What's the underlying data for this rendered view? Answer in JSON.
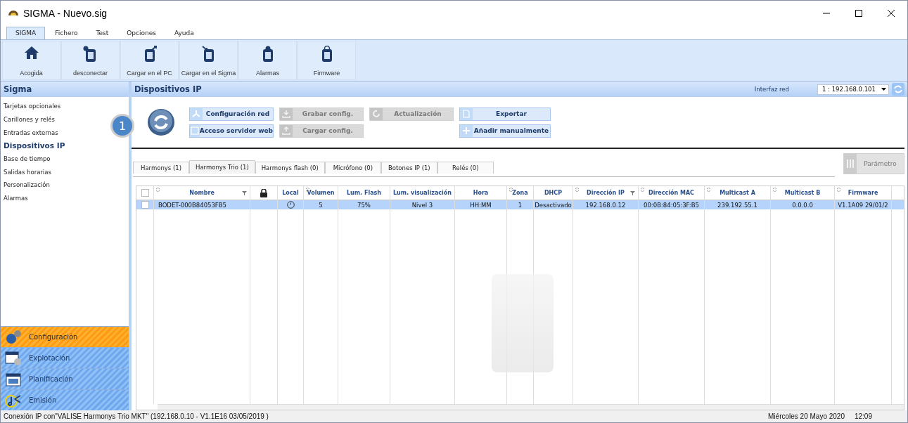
{
  "window": {
    "title": "SIGMA - Nuevo.sig"
  },
  "menu_tabs": [
    {
      "label": "SIGMA",
      "selected": true
    },
    {
      "label": "Fichero",
      "selected": false
    },
    {
      "label": "Test",
      "selected": false
    },
    {
      "label": "Opciones",
      "selected": false
    },
    {
      "label": "Ayuda",
      "selected": false
    }
  ],
  "ribbon": [
    {
      "label": "Acogida",
      "kind": "home"
    },
    {
      "label": "desconectar",
      "kind": "disconnect"
    },
    {
      "label": "Cargar en el PC",
      "kind": "upload"
    },
    {
      "label": "Cargar en el Sigma",
      "kind": "download"
    },
    {
      "label": "Alarmas",
      "kind": "alarm"
    },
    {
      "label": "Firmware",
      "kind": "firmware"
    }
  ],
  "sidebar": {
    "title": "Sigma",
    "items": [
      {
        "label": "Tarjetas opcionales",
        "selected": false
      },
      {
        "label": "Carillones y relés",
        "selected": false
      },
      {
        "label": "Entradas externas",
        "selected": false
      },
      {
        "label": "Dispositivos IP",
        "selected": true
      },
      {
        "label": "Base de tiempo",
        "selected": false
      },
      {
        "label": "Salidas horarias",
        "selected": false
      },
      {
        "label": "Personalización",
        "selected": false
      },
      {
        "label": "Alarmas",
        "selected": false
      }
    ],
    "sections": [
      {
        "label": "Configuración",
        "selected": true,
        "kind": "gears"
      },
      {
        "label": "Explotación",
        "selected": false,
        "kind": "window"
      },
      {
        "label": "Planificación",
        "selected": false,
        "kind": "calendar"
      },
      {
        "label": "Emisión",
        "selected": false,
        "kind": "music"
      }
    ]
  },
  "panel": {
    "title": "Dispositivos IP",
    "interface_label": "Interfaz red",
    "interface_value": "1 : 192.168.0.101",
    "callout": "1",
    "actions": [
      {
        "label": "Configuración red",
        "disabled": false,
        "kind": "network"
      },
      {
        "label": "Grabar config.",
        "disabled": true,
        "kind": "save"
      },
      {
        "label": "Actualización",
        "disabled": true,
        "kind": "update"
      },
      {
        "label": "Exportar",
        "disabled": false,
        "kind": "export"
      },
      {
        "label": "Acceso servidor web",
        "disabled": false,
        "kind": "web"
      },
      {
        "label": "Cargar config.",
        "disabled": true,
        "kind": "load"
      },
      {
        "label": "Añadir manualmente",
        "disabled": false,
        "kind": "add"
      }
    ],
    "device_tabs": [
      {
        "label": "Harmonys (1)",
        "selected": false
      },
      {
        "label": "Harmonys Trio (1)",
        "selected": true
      },
      {
        "label": "Harmonys flash (0)",
        "selected": false
      },
      {
        "label": "Micrófono (0)",
        "selected": false
      },
      {
        "label": "Botones IP (1)",
        "selected": false
      },
      {
        "label": "Relés (0)",
        "selected": false
      }
    ],
    "parameter_button": {
      "label": "Parámetro",
      "disabled": true
    }
  },
  "table": {
    "columns": [
      {
        "kind": "check",
        "checked": false,
        "sort": false,
        "filter": false
      },
      {
        "kind": "text",
        "label": "Nombre",
        "sort": true,
        "filter": true
      },
      {
        "kind": "lock",
        "sort": false,
        "filter": false
      },
      {
        "kind": "icon",
        "label": "Local",
        "sort": false,
        "filter": false
      },
      {
        "kind": "text",
        "label": "Volumen",
        "sort": true,
        "filter": false
      },
      {
        "kind": "text",
        "label": "Lum. Flash",
        "sort": false,
        "filter": false
      },
      {
        "kind": "text",
        "label": "Lum. visualización",
        "sort": false,
        "filter": false
      },
      {
        "kind": "text",
        "label": "Hora",
        "sort": false,
        "filter": false
      },
      {
        "kind": "text",
        "label": "Zona",
        "sort": true,
        "filter": false
      },
      {
        "kind": "text",
        "label": "DHCP",
        "sort": false,
        "filter": false
      },
      {
        "kind": "text",
        "label": "Dirección IP",
        "sort": true,
        "filter": true
      },
      {
        "kind": "text",
        "label": "Dirección MAC",
        "sort": true,
        "filter": false
      },
      {
        "kind": "text",
        "label": "Multicast A",
        "sort": true,
        "filter": false
      },
      {
        "kind": "text",
        "label": "Multicast B",
        "sort": true,
        "filter": false
      },
      {
        "kind": "text",
        "label": "Firmware",
        "sort": true,
        "filter": false
      }
    ],
    "rows": [
      {
        "checked": false,
        "selected": true,
        "cells": [
          "",
          "BODET-000B84053FB5",
          "",
          "",
          "5",
          "75%",
          "Nivel 3",
          "HH:MM",
          "1",
          "Desactivado",
          "192.168.0.12",
          "00:0B:84:05:3F:B5",
          "239.192.55.1",
          "0.0.0.0",
          "V1.1A09  29/01/2"
        ]
      }
    ]
  },
  "status_bar": {
    "connection": "Conexión IP con\"VALISE Harmonys Trio MKT\" (192.168.0.10 - V1.1E16  03/05/2019 )",
    "date": "Miércoles 20 Mayo 2020",
    "time": "12:09"
  }
}
